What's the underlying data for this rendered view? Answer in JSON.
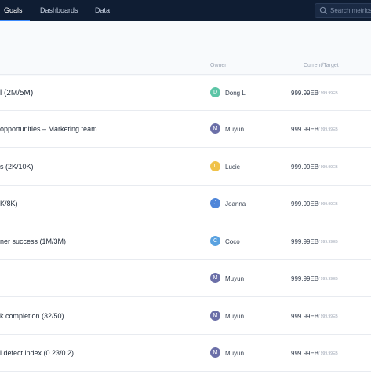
{
  "nav": {
    "tabs": [
      {
        "label": "Goals"
      },
      {
        "label": "Dashboards"
      },
      {
        "label": "Data"
      }
    ],
    "search_placeholder": "Search metrics"
  },
  "table": {
    "headers": {
      "owner": "Owner",
      "current_target": "Current/Target"
    },
    "rows": [
      {
        "name": "l (2M/5M)",
        "owner": "Dong Li",
        "initial": "D",
        "avatar_color": "#5cc5a6",
        "current": "999.99EB",
        "target": "/ 999.99EB"
      },
      {
        "name": "opportunities – Marketing team",
        "owner": "Muyun",
        "initial": "M",
        "avatar_color": "#6b6fa8",
        "current": "999.99EB",
        "target": "/ 999.99EB"
      },
      {
        "name": "s (2K/10K)",
        "owner": "Lucie",
        "initial": "L",
        "avatar_color": "#f0c24a",
        "current": "999.99EB",
        "target": "/ 999.99EB"
      },
      {
        "name": "K/8K)",
        "owner": "Joanna",
        "initial": "J",
        "avatar_color": "#4f86d9",
        "current": "999.99EB",
        "target": "/ 999.99EB"
      },
      {
        "name": "ner success (1M/3M)",
        "owner": "Coco",
        "initial": "C",
        "avatar_color": "#5aa2e0",
        "current": "999.99EB",
        "target": "/ 999.99EB"
      },
      {
        "name": "",
        "owner": "Muyun",
        "initial": "M",
        "avatar_color": "#6b6fa8",
        "current": "999.99EB",
        "target": "/ 999.99EB"
      },
      {
        "name": "k completion (32/50)",
        "owner": "Muyun",
        "initial": "M",
        "avatar_color": "#6b6fa8",
        "current": "999.99EB",
        "target": "/ 999.99EB"
      },
      {
        "name": "l defect index (0.23/0.2)",
        "owner": "Muyun",
        "initial": "M",
        "avatar_color": "#6b6fa8",
        "current": "999.99EB",
        "target": "/ 999.99EB"
      }
    ]
  },
  "colors": {
    "topbar": "#0f1d33",
    "accent": "#3d8bfd"
  }
}
